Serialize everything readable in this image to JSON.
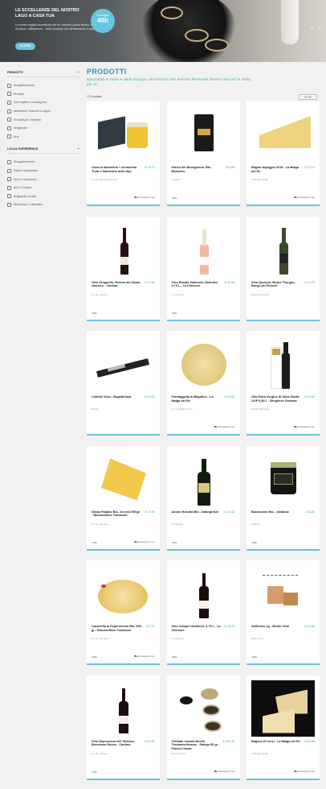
{
  "hero": {
    "title": "Le eccellenze del nostro Lago a casa tua",
    "subtitle": "Le nostre migliori eccellenze per te: cavolini, pesce fresco, formaggi di pesce, raffinatezze... tante prodotti così direttamente a casa",
    "button": "SCOPRI",
    "badge_top": "Consegna",
    "badge_value": "48h"
  },
  "sidebar": {
    "products_heading": "PRODOTTI",
    "products_items": [
      "Enogastronomia",
      "Prodotti",
      "Vino regalo e cooking box",
      "Abbinature Vinicole & coppie",
      "Prodotti per i bambini",
      "Artigianato",
      "Arte"
    ],
    "local_heading": "LOCAL EXPERIENCE",
    "local_items": [
      "Enogastronomia",
      "Relax e benessere",
      "Sport e avventura",
      "Arte e Cultura",
      "Artigianato locale",
      "Workshop e Laboratori"
    ]
  },
  "main": {
    "title": "PRODOTTI",
    "subtitle": "Specialità in Italia e dalla Europa, dai fornitori dei mercati Piemonte diversi mercati in Italia per te",
    "count": "171 risultati",
    "filter": "FILTRI"
  },
  "products": [
    {
      "name": "Uova di Salmerino + Arnametto Trota e Salmerino delle Alpi",
      "price": "€ 16,70",
      "seller": "Al Lago Allevamento Ittico",
      "bio": "",
      "delivery": "Consegna 3 ore"
    },
    {
      "name": "Infuso del Boongiorno. Bio - Bedovine",
      "price": "€ 4,80",
      "seller": "Jollyanna",
      "bio": "Bio",
      "delivery": ""
    },
    {
      "name": "Bugias Alpeggio 2018 - La Malga del Re",
      "price": "€ 37,10",
      "seller": "La Malga del Re",
      "bio": "",
      "delivery": "Consegna 3 ore"
    },
    {
      "name": "Vino Groppello, Riviera del Garda classico - Cantina",
      "price": "€ 12,90",
      "seller": "Az. Ag. Cantina",
      "bio": "Bio",
      "delivery": ""
    },
    {
      "name": "Vino Rosato Valtènesi Chiaretto 0,75 L - La Chiesure",
      "price": "€ 10,90",
      "seller": "La Chiesure",
      "bio": "Bio",
      "delivery": ""
    },
    {
      "name": "Vino Quorum, Muller Thurgau - Borgo dei Posseri",
      "price": "€ 14,70",
      "seller": "Borgo dei Posseri",
      "bio": "",
      "delivery": ""
    },
    {
      "name": "Coltello Vinzi - BugattiCasa",
      "price": "€ 19,20",
      "seller": "Bugatti",
      "bio": "",
      "delivery": ""
    },
    {
      "name": "Formaggella di Bagolino - La Malga del Re",
      "price": "€ 13,80",
      "seller": "Az. Ag. Malga del Re",
      "bio": "",
      "delivery": "Consegna 3 ore"
    },
    {
      "name": "Olio Extra Vergine di Oliva Garda DOP 0,50 L - Berghese Cavazza",
      "price": "€ 34,50",
      "seller": "Frantoio Berghese",
      "bio": "",
      "delivery": "Consegna 3 ore"
    },
    {
      "name": "Grana Padano Bio, 24 mesi 500gr - Biocaseificio Tomasoni",
      "price": "€ 11,90",
      "seller": "Az. Ag. Tomasoni",
      "bio": "Bio",
      "delivery": "Consegna 3 ore"
    },
    {
      "name": "Amaro Rosetta Bio - Naturgreste",
      "price": "€ 23,10",
      "seller": "Naturgreste",
      "bio": "Bio",
      "delivery": ""
    },
    {
      "name": "Basmonino Bio - Valdenai",
      "price": "€ 5,60",
      "seller": "Valdenai",
      "bio": "Bio",
      "delivery": ""
    },
    {
      "name": "Caciotella al Peperoncino Bio, 500 gr - Biocaseificio Tomasoni",
      "price": "€ 7,20",
      "seller": "Az. Ag. Tomasoni",
      "bio": "Bio",
      "delivery": "Consegna 3 ore"
    },
    {
      "name": "Vino Campel Unbinnet, 0,75 L - La Chiesure",
      "price": "€ 16,20",
      "seller": "La Chiesure",
      "bio": "Bio",
      "delivery": ""
    },
    {
      "name": "Zafferano 1g - Monte Vivai",
      "price": "€ 49,80",
      "seller": "Monte Vivai",
      "bio": "Bio",
      "delivery": ""
    },
    {
      "name": "Vino Neporcanza IGT Benaco Bresciano Rosso - Cantina",
      "price": "€ 20,90",
      "seller": "Az. Ag. Cantina",
      "bio": "Bio",
      "delivery": ""
    },
    {
      "name": "Vertiade Caviale Beneti Trerammellerame - Salugo 50 gr - Pemerl Caviar",
      "price": "€ 451,00",
      "seller": "Pemerl Caviar",
      "bio": "",
      "delivery": "Consegna 3 ore"
    },
    {
      "name": "Bagòss 60 mesi - La Malga del Re",
      "price": "€ 89,90",
      "seller": "La Malga del Re",
      "bio": "",
      "delivery": "Consegna 3 ore"
    }
  ]
}
